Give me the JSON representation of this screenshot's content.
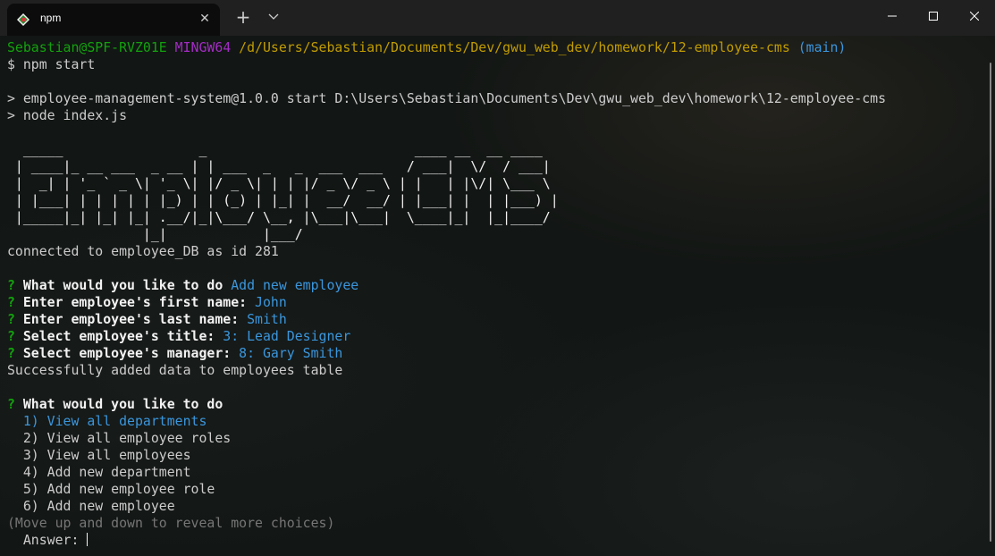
{
  "window": {
    "tab_title": "npm",
    "tab_close_icon": "close-icon",
    "new_tab_icon": "plus-icon",
    "dropdown_icon": "chevron-down-icon",
    "controls": [
      "minimize-icon",
      "maximize-icon",
      "close-icon"
    ]
  },
  "colors": {
    "background": "#0c0c0c",
    "titlebar": "#202020",
    "prompt_user": "#13a10e",
    "prompt_shell": "#a32cc4",
    "prompt_path": "#c19c00",
    "prompt_branch": "#3a96dd",
    "answer": "#3a96dd",
    "question_mark": "#13a10e",
    "hint": "#767676"
  },
  "terminal": {
    "prompt": {
      "user_host": "Sebastian@SPF-RVZ01E",
      "shell": "MINGW64",
      "path": "/d/Users/Sebastian/Documents/Dev/gwu_web_dev/homework/12-employee-cms",
      "branch": "(main)"
    },
    "command": "$ npm start",
    "npm_script_line": "> employee-management-system@1.0.0 start D:\\Users\\Sebastian\\Documents\\Dev\\gwu_web_dev\\homework\\12-employee-cms",
    "node_line": "> node index.js",
    "ascii_banner": "  _____                 _                          ____ __  __ ____\n | ____|_ __ ___  _ __ | | ___  _   _  ___  ___   / ___|  \\/  / ___|\n |  _| | '_ ` _ \\| '_ \\| |/ _ \\| | | |/ _ \\/ _ \\ | |   | |\\/| \\___ \\\n | |___| | | | | | |_) | | (_) | |_| |  __/  __/ | |___| |  | |___) |\n |_____|_| |_| |_| .__/|_|\\___/ \\__, |\\___|\\___|  \\____|_|  |_|____/\n                 |_|            |___/",
    "connected": "connected to employee_DB as id 281",
    "qa": [
      {
        "question": "What would you like to do",
        "answer": "Add new employee"
      },
      {
        "question": "Enter employee's first name:",
        "answer": "John"
      },
      {
        "question": "Enter employee's last name:",
        "answer": "Smith"
      },
      {
        "question": "Select employee's title:",
        "answer": "3: Lead Designer"
      },
      {
        "question": "Select employee's manager:",
        "answer": "8: Gary Smith"
      }
    ],
    "success": "Successfully added data to employees table",
    "current_question": "What would you like to do",
    "choices": [
      "1) View all departments",
      "2) View all employee roles",
      "3) View all employees",
      "4) Add new department",
      "5) Add new employee role",
      "6) Add new employee"
    ],
    "selected_choice_index": 0,
    "hint": "(Move up and down to reveal more choices)",
    "answer_prompt": "  Answer: "
  }
}
